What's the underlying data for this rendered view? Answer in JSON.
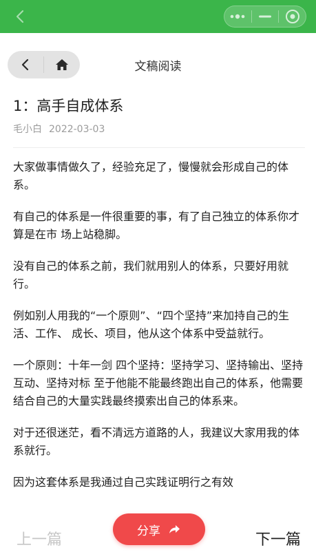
{
  "header": {
    "title": "文稿阅读"
  },
  "article": {
    "title": "1：高手自成体系",
    "author": "毛小白",
    "date": "2022-03-03",
    "paragraphs": [
      "大家做事情做久了，经验充足了，慢慢就会形成自己的体系。",
      "有自己的体系是一件很重要的事，有了自己独立的体系你才算是在市 场上站稳脚。",
      "没有自己的体系之前，我们就用别人的体系，只要好用就行。",
      "例如别人用我的“一个原则”、“四个坚持”来加持自己的生活、工作、 成长、项目，他从这个体系中受益就行。",
      "一个原则：十年一剑 四个坚持：坚持学习、坚持输出、坚持互动、坚持对标 至于他能不能最终跑出自己的体系，他需要结合自己的大量实践最终摸索出自己的体系来。",
      "对于还很迷茫，看不清远方道路的人，我建议大家用我的体系就行。",
      "因为这套体系是我通过自己实践证明行之有效"
    ]
  },
  "footer": {
    "prev_label": "上一篇",
    "next_label": "下一篇",
    "share_label": "分享"
  },
  "icons": {
    "back": "back-chevron-icon",
    "home": "home-icon",
    "more": "more-dots-icon",
    "minimize": "minimize-icon",
    "close": "close-circle-icon",
    "share": "share-arrow-icon"
  },
  "colors": {
    "topbar": "#3bb54a",
    "share_button": "#f0494a",
    "prev_disabled": "#c6c6c6"
  }
}
